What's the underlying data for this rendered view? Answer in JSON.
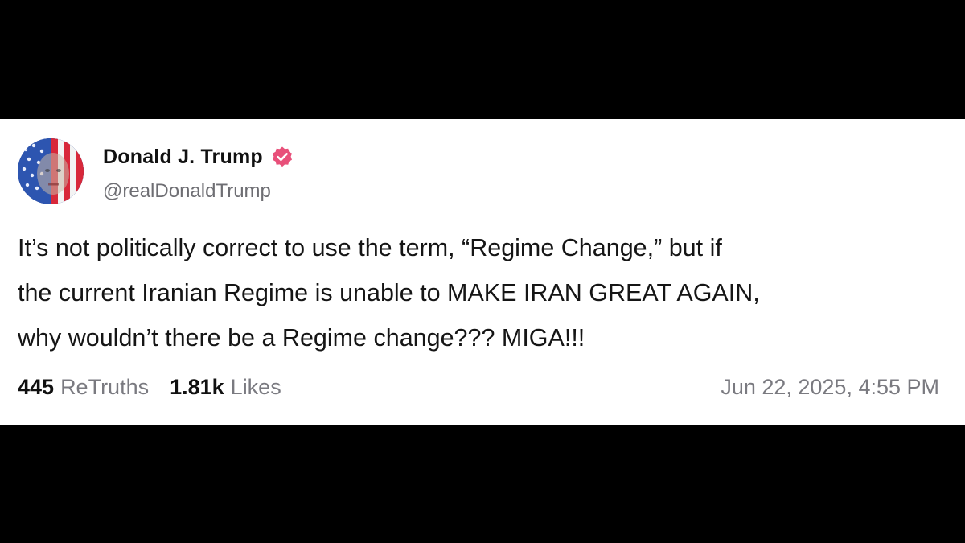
{
  "post": {
    "author": {
      "display_name": "Donald J. Trump",
      "handle": "@realDonaldTrump",
      "verified": true,
      "verified_badge_color": "#e8507a"
    },
    "text_lines": [
      "It’s not politically correct to use the term, “Regime Change,” but if",
      "the current Iranian Regime is unable to MAKE IRAN GREAT AGAIN,",
      "why wouldn’t there be a Regime change??? MIGA!!!"
    ],
    "stats": {
      "retruths_count": "445",
      "retruths_label": "ReTruths",
      "likes_count": "1.81k",
      "likes_label": "Likes"
    },
    "timestamp": "Jun 22, 2025, 4:55 PM"
  },
  "colors": {
    "background": "#000000",
    "card": "#ffffff",
    "primary_text": "#111111",
    "secondary_text": "#7a7a80"
  }
}
